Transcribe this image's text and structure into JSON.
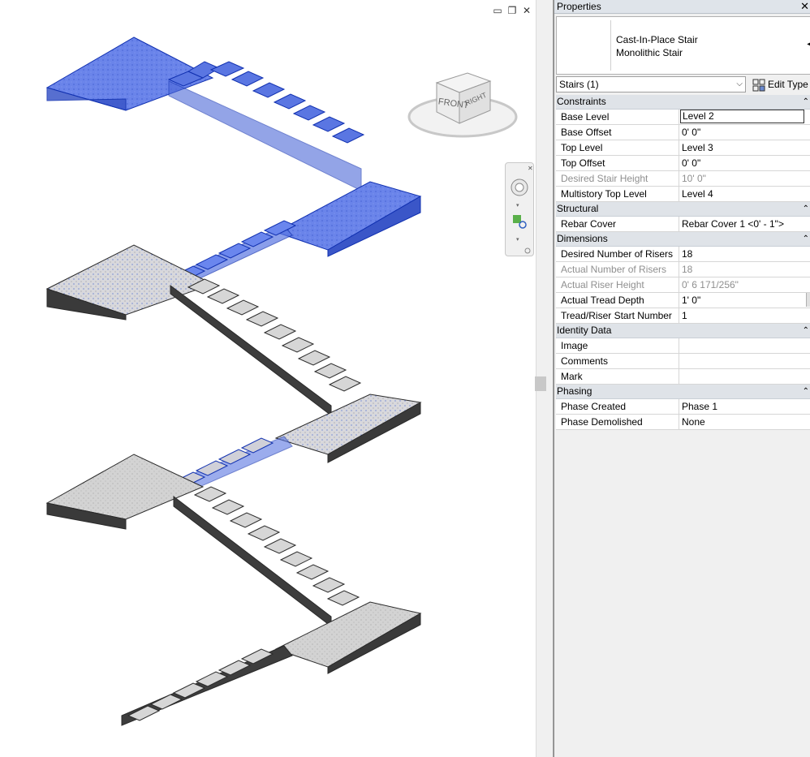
{
  "viewport": {
    "viewcube": {
      "front_label": "FRONT",
      "right_label": "RIGHT"
    },
    "window_controls": [
      "restore-down",
      "maximize",
      "close"
    ]
  },
  "properties": {
    "title": "Properties",
    "type_family": "Cast-In-Place Stair",
    "type_name": "Monolithic Stair",
    "instance_filter": "Stairs (1)",
    "edit_type_label": "Edit Type",
    "sections": [
      {
        "name": "Constraints",
        "rows": [
          {
            "label": "Base Level",
            "value": "Level 2",
            "readonly": false,
            "active": true
          },
          {
            "label": "Base Offset",
            "value": "0'  0\"",
            "readonly": false
          },
          {
            "label": "Top Level",
            "value": "Level 3",
            "readonly": false
          },
          {
            "label": "Top Offset",
            "value": "0'  0\"",
            "readonly": false
          },
          {
            "label": "Desired Stair Height",
            "value": "10'  0\"",
            "readonly": true
          },
          {
            "label": "Multistory Top Level",
            "value": "Level 4",
            "readonly": false
          }
        ]
      },
      {
        "name": "Structural",
        "rows": [
          {
            "label": "Rebar Cover",
            "value": "Rebar Cover 1 <0' - 1\">",
            "readonly": false
          }
        ]
      },
      {
        "name": "Dimensions",
        "rows": [
          {
            "label": "Desired Number of Risers",
            "value": "18",
            "readonly": false
          },
          {
            "label": "Actual Number of Risers",
            "value": "18",
            "readonly": true
          },
          {
            "label": "Actual Riser Height",
            "value": "0'  6 171/256\"",
            "readonly": true
          },
          {
            "label": "Actual Tread Depth",
            "value": "1'  0\"",
            "readonly": false,
            "button": true
          },
          {
            "label": "Tread/Riser Start Number",
            "value": "1",
            "readonly": false
          }
        ]
      },
      {
        "name": "Identity Data",
        "rows": [
          {
            "label": "Image",
            "value": "",
            "readonly": false
          },
          {
            "label": "Comments",
            "value": "",
            "readonly": false
          },
          {
            "label": "Mark",
            "value": "",
            "readonly": false
          }
        ]
      },
      {
        "name": "Phasing",
        "rows": [
          {
            "label": "Phase Created",
            "value": "Phase 1",
            "readonly": false
          },
          {
            "label": "Phase Demolished",
            "value": "None",
            "readonly": false
          }
        ]
      }
    ]
  }
}
